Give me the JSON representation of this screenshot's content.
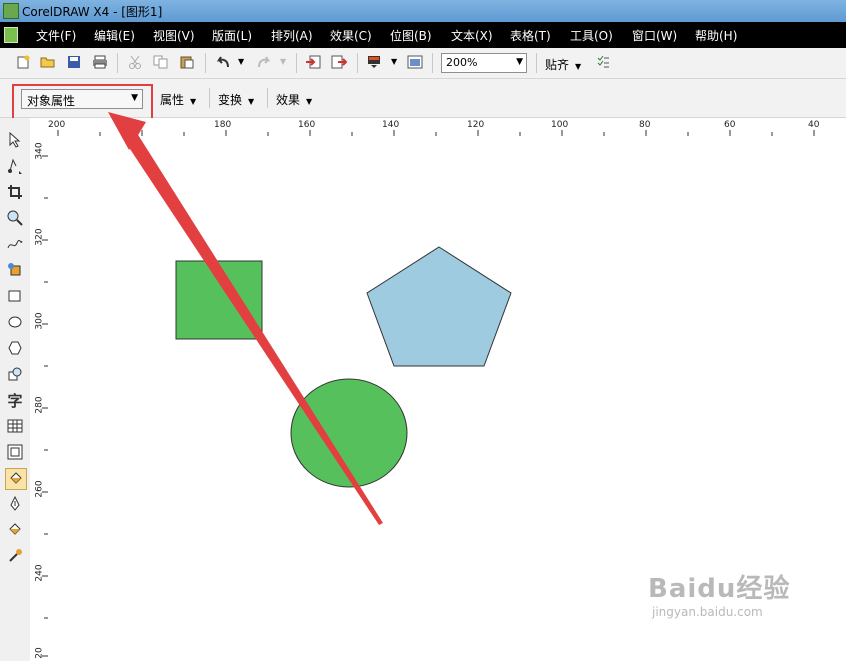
{
  "window": {
    "title": "CorelDRAW X4 - [图形1]"
  },
  "menu": [
    "文件(F)",
    "编辑(E)",
    "视图(V)",
    "版面(L)",
    "排列(A)",
    "效果(C)",
    "位图(B)",
    "文本(X)",
    "表格(T)",
    "工具(O)",
    "窗口(W)",
    "帮助(H)"
  ],
  "toolbar": {
    "zoom_value": "200%",
    "snap_label": "贴齐"
  },
  "property_bar": {
    "dropdown_value": "对象属性",
    "properties_label": "属性",
    "transform_label": "变换",
    "effects_label": "效果"
  },
  "ruler_h": [
    "200",
    "180",
    "160",
    "140",
    "120",
    "100",
    "80",
    "60",
    "40"
  ],
  "ruler_v": [
    "340",
    "320",
    "300",
    "280",
    "260",
    "240",
    "20"
  ],
  "shapes": {
    "rect_color": "#56c05c",
    "pentagon_color": "#9ecbe0",
    "ellipse_color": "#56c05c"
  },
  "annotation": {
    "color": "#e24040"
  },
  "watermark": {
    "logo": "Baidu经验",
    "url": "jingyan.baidu.com"
  }
}
